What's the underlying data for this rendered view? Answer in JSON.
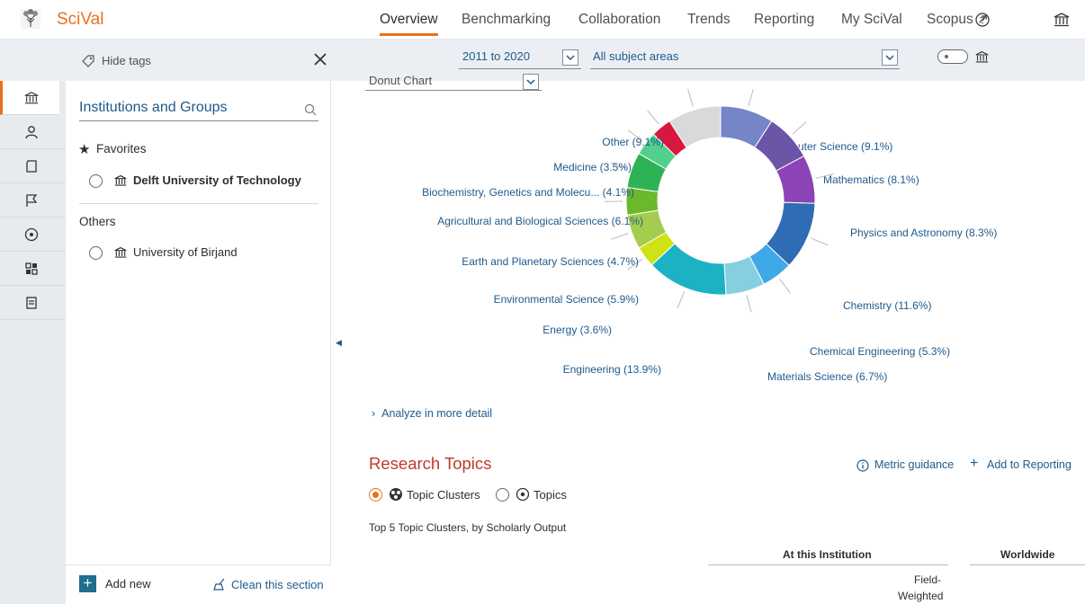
{
  "app": {
    "brand": "SciVal"
  },
  "nav": {
    "items": [
      "Overview",
      "Benchmarking",
      "Collaboration",
      "Trends",
      "Reporting",
      "My SciVal",
      "Scopus ↗"
    ],
    "active": "Overview"
  },
  "filters": {
    "hide_tags": "Hide tags",
    "period": "2011 to 2020",
    "subject": "All subject areas"
  },
  "sidebar": {
    "title": "Institutions and Groups",
    "favorites_label": "Favorites",
    "favorite_institution": "Delft University of Technology",
    "others_label": "Others",
    "other_institution": "University of Birjand",
    "add_new": "Add new",
    "clean_section": "Clean this section"
  },
  "main": {
    "chart_select": "Donut Chart",
    "analyze_link": "Analyze in more detail",
    "research_topics_title": "Research Topics",
    "metric_guidance": "Metric guidance",
    "add_to_reporting": "Add to Reporting",
    "option_topic_clusters": "Topic Clusters",
    "option_topics": "Topics",
    "top5_caption": "Top 5 Topic Clusters, by Scholarly Output",
    "col_at_institution": "At this Institution",
    "col_worldwide": "Worldwide",
    "col_fw_1": "Field-",
    "col_fw_2": "Weighted"
  },
  "chart_data": {
    "type": "pie",
    "donut": true,
    "unit": "%",
    "slices": [
      {
        "label": "Computer Science (9.1%)",
        "value": 9.1,
        "color": "#7585c7"
      },
      {
        "label": "Mathematics (8.1%)",
        "value": 8.1,
        "color": "#6a55a6"
      },
      {
        "label": "Physics and Astronomy (8.3%)",
        "value": 8.3,
        "color": "#8b43b6"
      },
      {
        "label": "Chemistry (11.6%)",
        "value": 11.6,
        "color": "#2e6cb5"
      },
      {
        "label": "Chemical Engineering (5.3%)",
        "value": 5.3,
        "color": "#3fa9e8"
      },
      {
        "label": "Materials Science (6.7%)",
        "value": 6.7,
        "color": "#86cfe0"
      },
      {
        "label": "Engineering (13.9%)",
        "value": 13.9,
        "color": "#1bb3c4"
      },
      {
        "label": "Energy (3.6%)",
        "value": 3.6,
        "color": "#cfe314"
      },
      {
        "label": "Environmental Science (5.9%)",
        "value": 5.9,
        "color": "#a4cc4e"
      },
      {
        "label": "Earth and Planetary Sciences (4.7%)",
        "value": 4.7,
        "color": "#6cb82b"
      },
      {
        "label": "Agricultural and Biological Sciences (6.1%)",
        "value": 6.1,
        "color": "#2db356"
      },
      {
        "label": "Biochemistry, Genetics and Molecu... (4.1%)",
        "value": 4.1,
        "color": "#52cf8c"
      },
      {
        "label": "Medicine (3.5%)",
        "value": 3.5,
        "color": "#d6183f"
      },
      {
        "label": "Other (9.1%)",
        "value": 9.1,
        "color": "#d9d9d9"
      }
    ]
  }
}
